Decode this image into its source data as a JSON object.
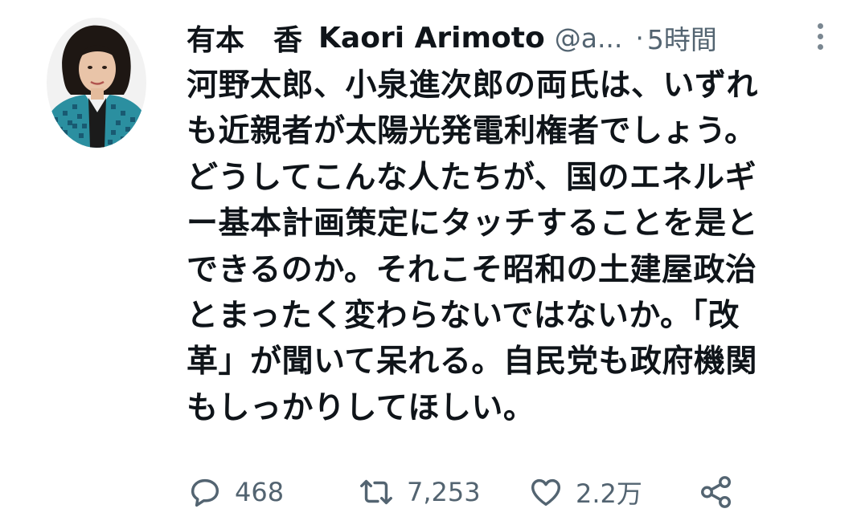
{
  "tweet": {
    "display_name": "有本　香",
    "author_name": "Kaori Arimoto",
    "handle": "@a...",
    "separator": "·",
    "time": "5時間",
    "text_lines": [
      "河野太郎、小泉進次郎の両氏は、いずれ",
      "も近親者が太陽光発電利権者でしょう。",
      "どうしてこんな人たちが、国のエネルギ",
      "ー基本計画策定にタッチすることを是と",
      "できるのか。それこそ昭和の土建屋政治",
      "とまったく変わらないではないか。「改",
      "革」が聞いて呆れる。自民党も政府機関",
      "もしっかりしてほしい。"
    ]
  },
  "actions": {
    "reply_count": "468",
    "retweet_count": "7,253",
    "like_count": "2.2万"
  },
  "icons": {
    "reply": "speech-bubble-icon",
    "retweet": "retweet-arrows-icon",
    "like": "heart-outline-icon",
    "share": "share-nodes-icon",
    "more": "vertical-ellipsis-icon"
  },
  "colors": {
    "text_primary": "#0f1419",
    "text_secondary": "#536471"
  }
}
